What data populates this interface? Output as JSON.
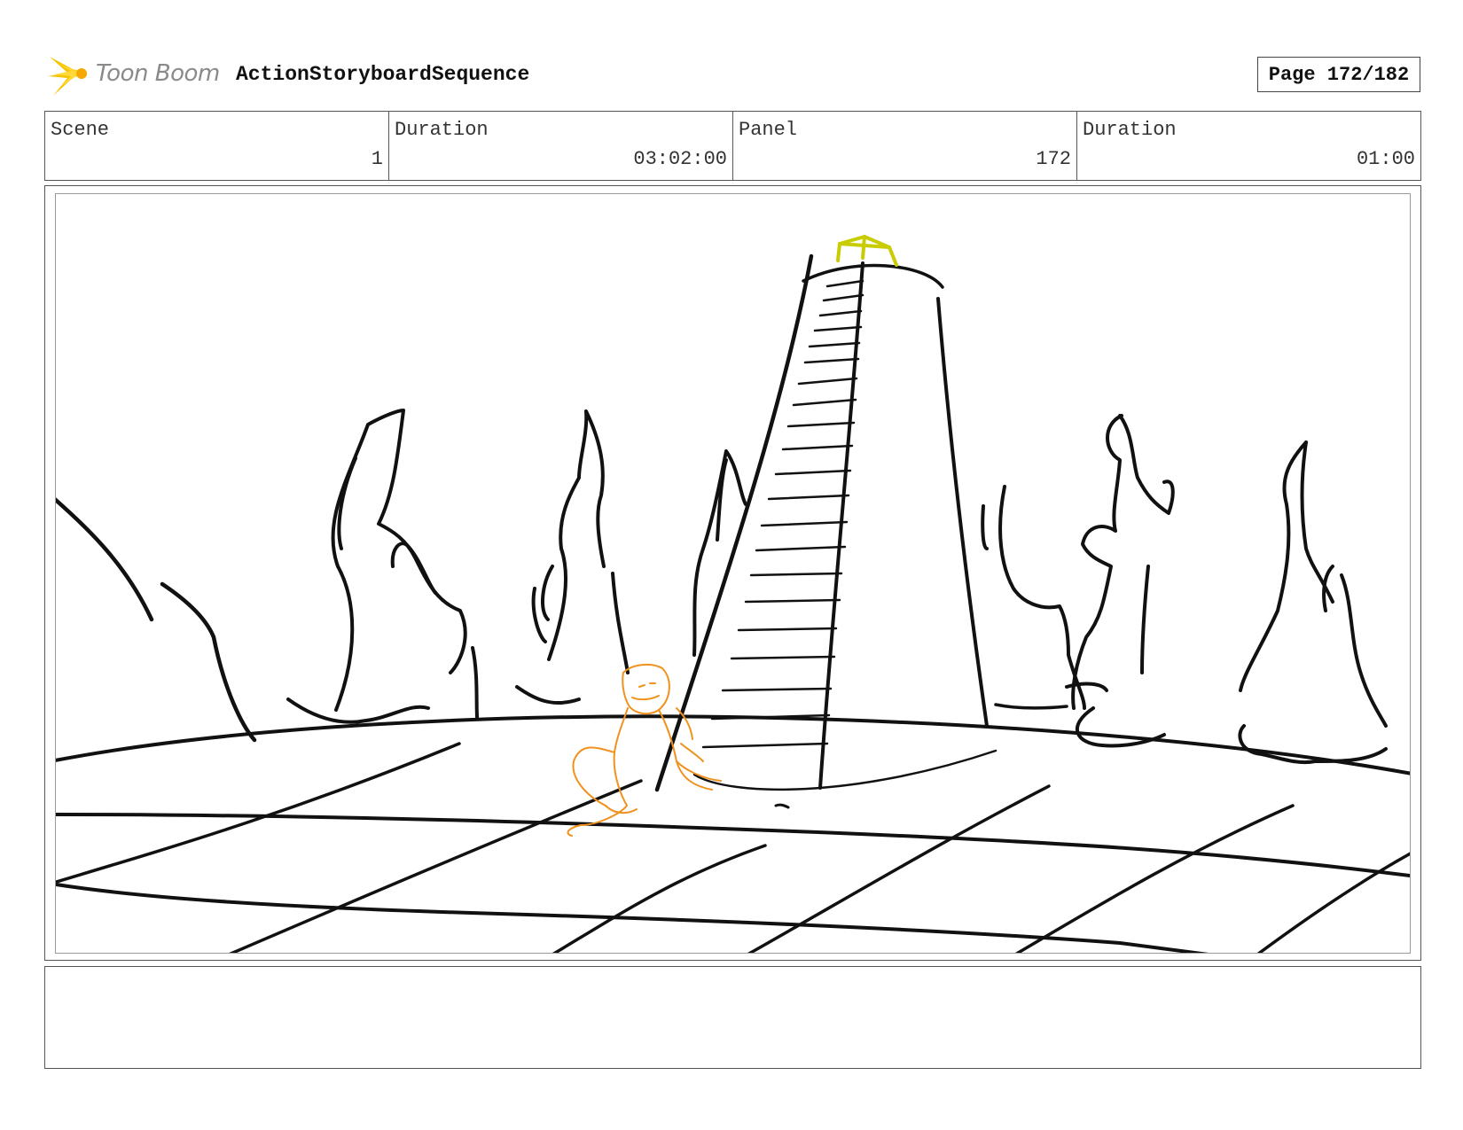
{
  "header": {
    "logo_text": "Toon Boom",
    "project_title": "ActionStoryboardSequence",
    "page_label": "Page 172/182"
  },
  "info": {
    "scene_label": "Scene",
    "scene_value": "1",
    "scene_duration_label": "Duration",
    "scene_duration_value": "03:02:00",
    "panel_label": "Panel",
    "panel_value": "172",
    "panel_duration_label": "Duration",
    "panel_duration_value": "01:00"
  },
  "notes": {
    "text": ""
  },
  "colors": {
    "logo_yellow": "#f5c400",
    "sketch_black": "#111111",
    "sketch_orange": "#f0921e",
    "sketch_yellow": "#c8cc00"
  }
}
